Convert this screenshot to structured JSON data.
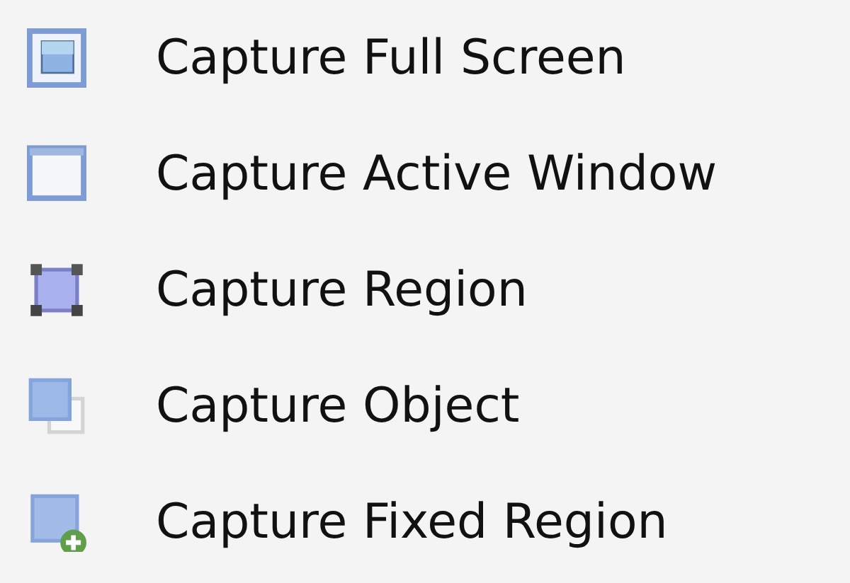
{
  "menu_items": [
    {
      "kind": "full-screen",
      "label": "Capture Full Screen"
    },
    {
      "kind": "window",
      "label": "Capture Active Window"
    },
    {
      "kind": "region",
      "label": "Capture Region"
    },
    {
      "kind": "object",
      "label": "Capture Object"
    },
    {
      "kind": "fixed-region",
      "label": "Capture Fixed Region"
    }
  ]
}
